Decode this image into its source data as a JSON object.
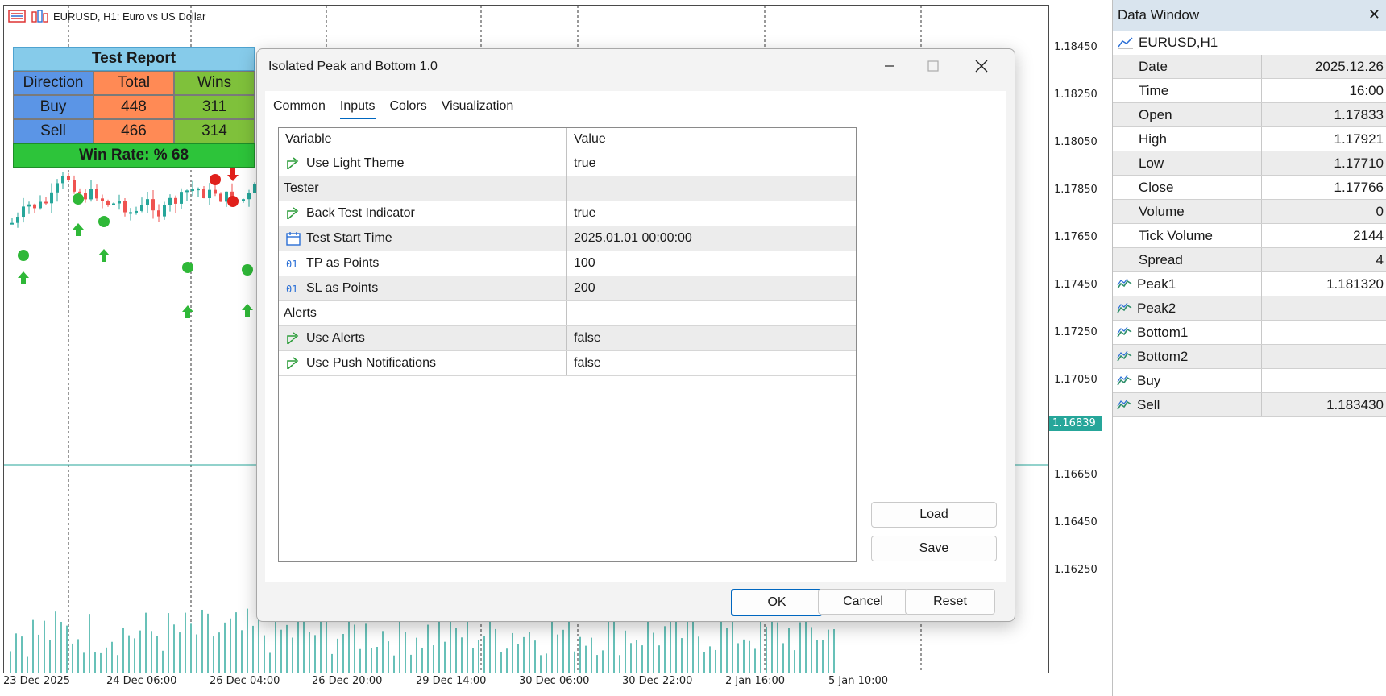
{
  "chart": {
    "header_title": "EURUSD, H1:  Euro vs US Dollar",
    "price_labels": [
      "1.18450",
      "1.18250",
      "1.18050",
      "1.17850",
      "1.17650",
      "1.17450",
      "1.17250",
      "1.17050",
      "1.16650",
      "1.16450",
      "1.16250"
    ],
    "current_price": "1.16839",
    "time_labels": [
      "23 Dec 2025",
      "24 Dec 06:00",
      "26 Dec 04:00",
      "26 Dec 20:00",
      "29 Dec 14:00",
      "30 Dec 06:00",
      "30 Dec 22:00",
      "2 Jan 16:00",
      "5 Jan 10:00"
    ],
    "colors": {
      "bull": "#26a69a",
      "bear": "#ef5350",
      "buy_signal": "#2fb838",
      "sell_signal": "#e0201b",
      "current_price_bg": "#26a69a"
    },
    "signal_markers": [
      "buy-arrow-icon",
      "sell-arrow-icon",
      "badge-1-icon",
      "badge-2-icon"
    ]
  },
  "test_report": {
    "title": "Test Report",
    "headers": [
      "Direction",
      "Total",
      "Wins"
    ],
    "rows": [
      {
        "direction": "Buy",
        "total": "448",
        "wins": "311"
      },
      {
        "direction": "Sell",
        "total": "466",
        "wins": "314"
      }
    ],
    "footer": "Win Rate: %  68"
  },
  "dialog": {
    "title": "Isolated Peak and Bottom 1.0",
    "tabs": [
      "Common",
      "Inputs",
      "Colors",
      "Visualization"
    ],
    "active_tab": "Inputs",
    "columns": [
      "Variable",
      "Value"
    ],
    "rows": [
      {
        "icon": "bool-param-icon",
        "variable": "Use Light Theme",
        "value": "true"
      },
      {
        "icon": "",
        "variable": "Tester",
        "value": ""
      },
      {
        "icon": "bool-param-icon",
        "variable": "Back Test Indicator",
        "value": "true"
      },
      {
        "icon": "calendar-icon",
        "variable": "Test Start Time",
        "value": "2025.01.01 00:00:00"
      },
      {
        "icon": "integer-param-icon",
        "variable": "TP as Points",
        "value": "100"
      },
      {
        "icon": "integer-param-icon",
        "variable": "SL as Points",
        "value": "200"
      },
      {
        "icon": "",
        "variable": "Alerts",
        "value": ""
      },
      {
        "icon": "bool-param-icon",
        "variable": "Use Alerts",
        "value": "false"
      },
      {
        "icon": "bool-param-icon",
        "variable": "Use Push Notifications",
        "value": "false"
      }
    ],
    "load_label": "Load",
    "save_label": "Save",
    "ok_label": "OK",
    "cancel_label": "Cancel",
    "reset_label": "Reset"
  },
  "data_window": {
    "title": "Data Window",
    "symbol": "EURUSD,H1",
    "rows": [
      {
        "name": "Date",
        "value": "2025.12.26",
        "icon": ""
      },
      {
        "name": "Time",
        "value": "16:00",
        "icon": ""
      },
      {
        "name": "Open",
        "value": "1.17833",
        "icon": ""
      },
      {
        "name": "High",
        "value": "1.17921",
        "icon": ""
      },
      {
        "name": "Low",
        "value": "1.17710",
        "icon": ""
      },
      {
        "name": "Close",
        "value": "1.17766",
        "icon": ""
      },
      {
        "name": "Volume",
        "value": "0",
        "icon": ""
      },
      {
        "name": "Tick Volume",
        "value": "2144",
        "icon": ""
      },
      {
        "name": "Spread",
        "value": "4",
        "icon": ""
      },
      {
        "name": "Peak1",
        "value": "1.181320",
        "icon": "indicator-line-icon"
      },
      {
        "name": "Peak2",
        "value": "",
        "icon": "indicator-line-icon"
      },
      {
        "name": "Bottom1",
        "value": "",
        "icon": "indicator-line-icon"
      },
      {
        "name": "Bottom2",
        "value": "",
        "icon": "indicator-line-icon"
      },
      {
        "name": "Buy",
        "value": "",
        "icon": "indicator-line-icon"
      },
      {
        "name": "Sell",
        "value": "1.183430",
        "icon": "indicator-line-icon"
      }
    ]
  }
}
